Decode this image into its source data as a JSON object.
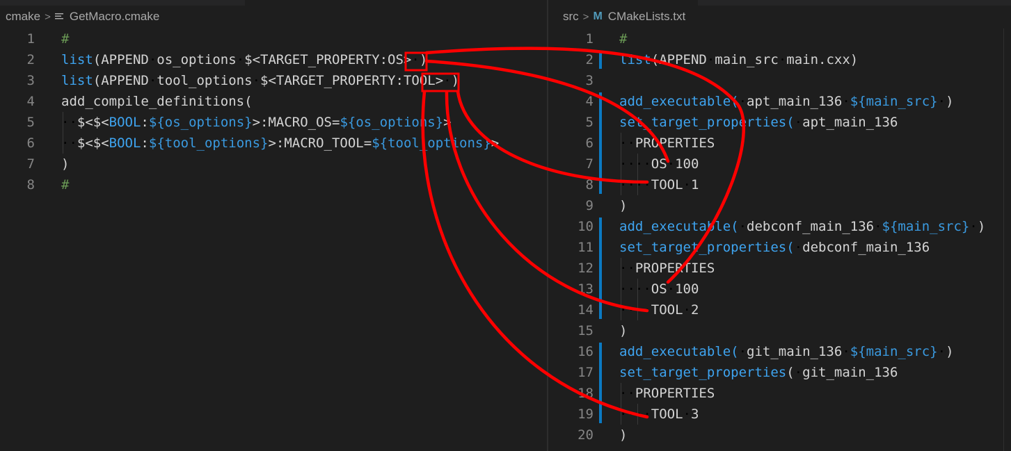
{
  "left_pane": {
    "breadcrumb": {
      "folder": "cmake",
      "sep": ">",
      "file": "GetMacro.cmake",
      "file_icon": "lines-file-icon"
    },
    "lines": [
      {
        "num": "1",
        "tokens": [
          {
            "t": "#",
            "c": "com"
          }
        ]
      },
      {
        "num": "2",
        "tokens": [
          {
            "t": "list",
            "c": "kw"
          },
          {
            "t": "(APPEND",
            "c": "txt"
          },
          {
            "t": "·",
            "c": "ws"
          },
          {
            "t": "os_options",
            "c": "txt"
          },
          {
            "t": "·",
            "c": "ws"
          },
          {
            "t": "$<TARGET_PROPERTY:OS>",
            "c": "txt"
          },
          {
            "t": "·",
            "c": "ws"
          },
          {
            "t": ")",
            "c": "txt"
          }
        ]
      },
      {
        "num": "3",
        "tokens": [
          {
            "t": "list",
            "c": "kw"
          },
          {
            "t": "(APPEND",
            "c": "txt"
          },
          {
            "t": "·",
            "c": "ws"
          },
          {
            "t": "tool_options",
            "c": "txt"
          },
          {
            "t": "·",
            "c": "ws"
          },
          {
            "t": "$<TARGET_PROPERTY:TOOL>",
            "c": "txt"
          },
          {
            "t": "·",
            "c": "ws"
          },
          {
            "t": ")",
            "c": "txt"
          }
        ]
      },
      {
        "num": "4",
        "tokens": [
          {
            "t": "add_compile_definitions(",
            "c": "txt"
          }
        ]
      },
      {
        "num": "5",
        "tokens": [
          {
            "t": "··",
            "c": "ws"
          },
          {
            "t": "$<$<",
            "c": "txt"
          },
          {
            "t": "BOOL",
            "c": "kw"
          },
          {
            "t": ":",
            "c": "txt"
          },
          {
            "t": "${os_options}",
            "c": "var"
          },
          {
            "t": ">:MACRO_OS=",
            "c": "txt"
          },
          {
            "t": "${os_options}",
            "c": "var"
          },
          {
            "t": ">",
            "c": "txt"
          }
        ]
      },
      {
        "num": "6",
        "tokens": [
          {
            "t": "··",
            "c": "ws"
          },
          {
            "t": "$<$<",
            "c": "txt"
          },
          {
            "t": "BOOL",
            "c": "kw"
          },
          {
            "t": ":",
            "c": "txt"
          },
          {
            "t": "${tool_options}",
            "c": "var"
          },
          {
            "t": ">:MACRO_TOOL=",
            "c": "txt"
          },
          {
            "t": "${tool_options}",
            "c": "var"
          },
          {
            "t": ">",
            "c": "txt"
          }
        ]
      },
      {
        "num": "7",
        "tokens": [
          {
            "t": ")",
            "c": "txt"
          }
        ]
      },
      {
        "num": "8",
        "tokens": [
          {
            "t": "#",
            "c": "com"
          }
        ]
      }
    ]
  },
  "right_pane": {
    "breadcrumb": {
      "folder": "src",
      "sep": ">",
      "file": "CMakeLists.txt",
      "file_icon": "M"
    },
    "lines": [
      {
        "num": "1",
        "tokens": [
          {
            "t": "#",
            "c": "com"
          }
        ]
      },
      {
        "num": "2",
        "tokens": [
          {
            "t": "list",
            "c": "kw"
          },
          {
            "t": "(APPEND",
            "c": "txt"
          },
          {
            "t": "·",
            "c": "ws"
          },
          {
            "t": "main_src",
            "c": "txt"
          },
          {
            "t": "·",
            "c": "ws"
          },
          {
            "t": "main.cxx)",
            "c": "txt"
          }
        ]
      },
      {
        "num": "3",
        "tokens": []
      },
      {
        "num": "4",
        "tokens": [
          {
            "t": "add_executable(",
            "c": "kw"
          },
          {
            "t": "·",
            "c": "ws"
          },
          {
            "t": "apt_main_136",
            "c": "txt"
          },
          {
            "t": "·",
            "c": "ws"
          },
          {
            "t": "${main_src}",
            "c": "var"
          },
          {
            "t": "·",
            "c": "ws"
          },
          {
            "t": ")",
            "c": "txt"
          }
        ]
      },
      {
        "num": "5",
        "tokens": [
          {
            "t": "set_target_properties(",
            "c": "kw"
          },
          {
            "t": "·",
            "c": "ws"
          },
          {
            "t": "apt_main_136",
            "c": "txt"
          }
        ]
      },
      {
        "num": "6",
        "tokens": [
          {
            "t": "··",
            "c": "ws"
          },
          {
            "t": "PROPERTIES",
            "c": "txt"
          }
        ]
      },
      {
        "num": "7",
        "tokens": [
          {
            "t": "····",
            "c": "ws"
          },
          {
            "t": "OS",
            "c": "txt"
          },
          {
            "t": "·",
            "c": "ws"
          },
          {
            "t": "100",
            "c": "txt"
          }
        ]
      },
      {
        "num": "8",
        "tokens": [
          {
            "t": "····",
            "c": "ws"
          },
          {
            "t": "TOOL",
            "c": "txt"
          },
          {
            "t": "·",
            "c": "ws"
          },
          {
            "t": "1",
            "c": "txt"
          }
        ]
      },
      {
        "num": "9",
        "tokens": [
          {
            "t": ")",
            "c": "txt"
          }
        ]
      },
      {
        "num": "10",
        "tokens": [
          {
            "t": "add_executable(",
            "c": "kw"
          },
          {
            "t": "·",
            "c": "ws"
          },
          {
            "t": "debconf_main_136",
            "c": "txt"
          },
          {
            "t": "·",
            "c": "ws"
          },
          {
            "t": "${main_src}",
            "c": "var"
          },
          {
            "t": "·",
            "c": "ws"
          },
          {
            "t": ")",
            "c": "txt"
          }
        ]
      },
      {
        "num": "11",
        "tokens": [
          {
            "t": "set_target_properties(",
            "c": "kw"
          },
          {
            "t": "·",
            "c": "ws"
          },
          {
            "t": "debconf_main_136",
            "c": "txt"
          }
        ]
      },
      {
        "num": "12",
        "tokens": [
          {
            "t": "··",
            "c": "ws"
          },
          {
            "t": "PROPERTIES",
            "c": "txt"
          }
        ]
      },
      {
        "num": "13",
        "tokens": [
          {
            "t": "····",
            "c": "ws"
          },
          {
            "t": "OS",
            "c": "txt"
          },
          {
            "t": "·",
            "c": "ws"
          },
          {
            "t": "100",
            "c": "txt"
          }
        ]
      },
      {
        "num": "14",
        "tokens": [
          {
            "t": "····",
            "c": "ws"
          },
          {
            "t": "TOOL",
            "c": "txt"
          },
          {
            "t": "·",
            "c": "ws"
          },
          {
            "t": "2",
            "c": "txt"
          }
        ]
      },
      {
        "num": "15",
        "tokens": [
          {
            "t": ")",
            "c": "txt"
          }
        ]
      },
      {
        "num": "16",
        "tokens": [
          {
            "t": "add_executable(",
            "c": "kw"
          },
          {
            "t": "·",
            "c": "ws"
          },
          {
            "t": "git_main_136",
            "c": "txt"
          },
          {
            "t": "·",
            "c": "ws"
          },
          {
            "t": "${main_src}",
            "c": "var"
          },
          {
            "t": "·",
            "c": "ws"
          },
          {
            "t": ")",
            "c": "txt"
          }
        ]
      },
      {
        "num": "17",
        "tokens": [
          {
            "t": "set_target_properties",
            "c": "kw"
          },
          {
            "t": "(",
            "c": "txt"
          },
          {
            "t": "·",
            "c": "ws"
          },
          {
            "t": "git_main_136",
            "c": "txt"
          }
        ]
      },
      {
        "num": "18",
        "tokens": [
          {
            "t": "··",
            "c": "ws"
          },
          {
            "t": "PROPERTIES",
            "c": "txt"
          }
        ]
      },
      {
        "num": "19",
        "tokens": [
          {
            "t": "····",
            "c": "ws"
          },
          {
            "t": "TOOL",
            "c": "txt"
          },
          {
            "t": "·",
            "c": "ws"
          },
          {
            "t": "3",
            "c": "txt"
          }
        ]
      },
      {
        "num": "20",
        "tokens": [
          {
            "t": ")",
            "c": "txt"
          }
        ]
      }
    ]
  },
  "colors": {
    "keyword": "#3ea4f0",
    "variable": "#3a9ae0",
    "comment": "#6a9955",
    "text": "#d4d4d4",
    "whitespace_marker": "#4a4a4a",
    "gutter": "#858585",
    "modified_bar": "#0b7ac2",
    "annotation": "#ff0000"
  }
}
